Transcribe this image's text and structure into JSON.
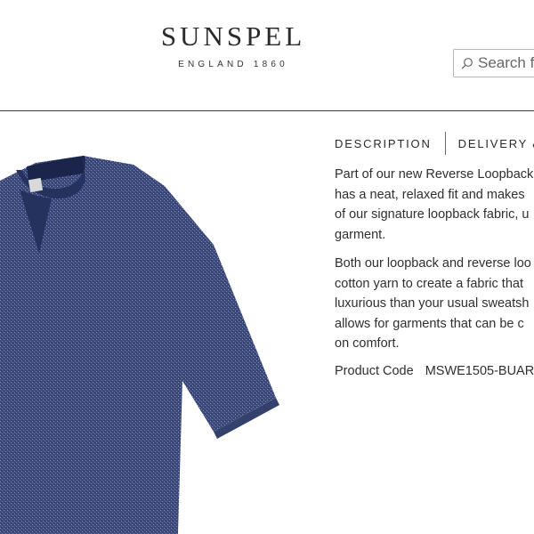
{
  "header": {
    "logo_wordmark": "SUNSPEL",
    "logo_tagline": "ENGLAND 1860",
    "search_placeholder": "Search f"
  },
  "product": {
    "image_name": "navy reverse loopback t-shirt"
  },
  "details": {
    "tabs": [
      {
        "label": "DESCRIPTION"
      },
      {
        "label": "DELIVERY &"
      }
    ],
    "description": {
      "paragraph_1": [
        "Part of our new Reverse Loopback",
        "has a neat, relaxed fit and makes",
        "of our signature loopback fabric, u",
        "garment."
      ],
      "paragraph_2": [
        "Both our loopback and reverse loo",
        "cotton yarn to create a fabric that",
        "luxurious than your usual sweatsh",
        "allows for garments that can be c",
        "on comfort."
      ]
    },
    "product_code_label": "Product Code",
    "product_code_value": "MSWE1505-BUAR"
  },
  "colors": {
    "garment": "#3b4a79",
    "rib_trim": "#1f2a55",
    "text": "#2f2f2f"
  }
}
